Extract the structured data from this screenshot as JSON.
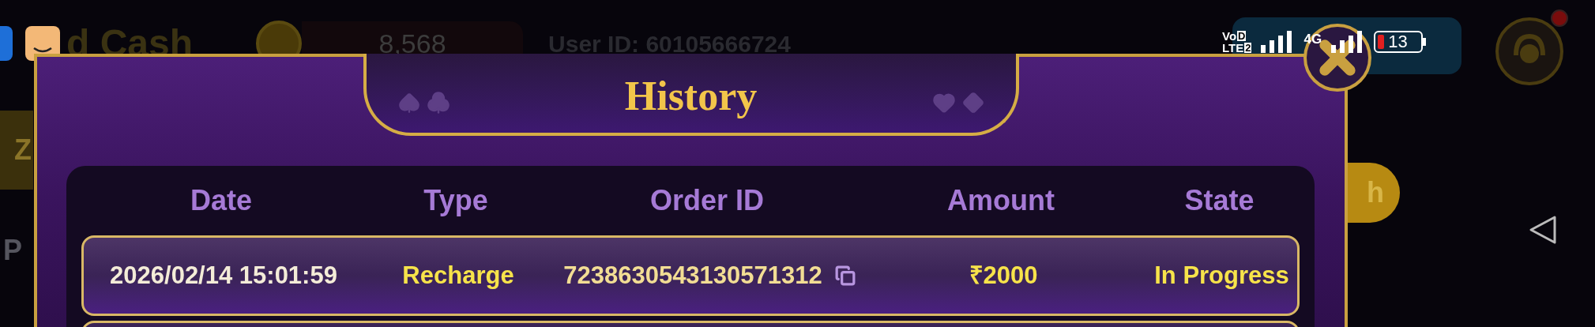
{
  "background": {
    "app_title": "d Cash",
    "coins": "8,568",
    "user_id": "User ID: 60105666724",
    "side_labels": [
      "Z",
      "P"
    ],
    "side_button": "h"
  },
  "status_bar": {
    "volte": "Vo",
    "volte_box": "D",
    "lte": "LTE",
    "sim": "2",
    "network_type": "4G",
    "battery": "13"
  },
  "dialog": {
    "title": "History",
    "columns": [
      "Date",
      "Type",
      "Order ID",
      "Amount",
      "State"
    ],
    "rows": [
      {
        "date": "2026/02/14 15:01:59",
        "type": "Recharge",
        "order_id": "7238630543130571312",
        "amount": "₹2000",
        "state": "In Progress"
      }
    ]
  }
}
